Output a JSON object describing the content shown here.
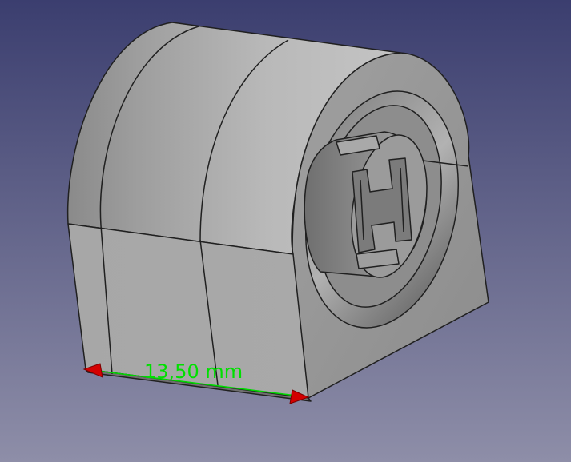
{
  "viewport": {
    "background_top": "#3b3e6f",
    "background_bottom": "#8e8ea8"
  },
  "model": {
    "face_light": "#b4b4b4",
    "face_mid": "#a3a3a3",
    "face_dark": "#7a7a7a",
    "edge_color": "#202020"
  },
  "measurement": {
    "label": "13,50 mm",
    "line_color": "#00d800",
    "text_color": "#00e000",
    "arrow_color": "#d40000",
    "arrow_shape": "cone-arrowhead"
  }
}
